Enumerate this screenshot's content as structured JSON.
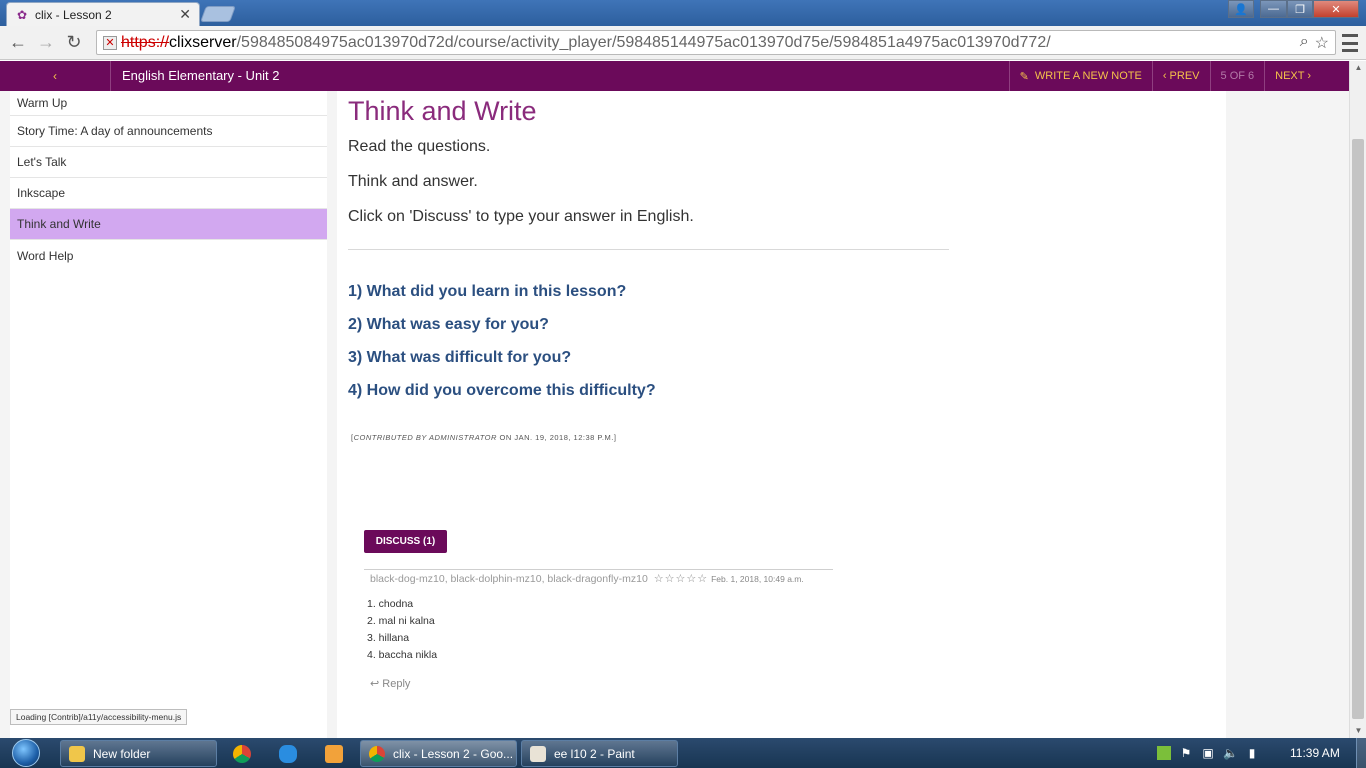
{
  "browser": {
    "tab_title": "clix - Lesson 2",
    "url": {
      "scheme": "https://",
      "host": "clixserver",
      "path": "/598485084975ac013970d72d/course/activity_player/598485144975ac013970d75e/5984851a4975ac013970d772/"
    }
  },
  "header": {
    "back_label": "‹",
    "unit_title": "English Elementary - Unit 2",
    "write_note_label": "WRITE A NEW NOTE",
    "prev_label": "‹ PREV",
    "pager_label": "5 OF 6",
    "next_label": "NEXT ›"
  },
  "sidebar": {
    "items": [
      {
        "label": "Warm Up"
      },
      {
        "label": "Story Time: A day of announcements"
      },
      {
        "label": "Let's Talk"
      },
      {
        "label": "Inkscape"
      },
      {
        "label": "Think and Write",
        "active": true
      },
      {
        "label": "Word Help"
      }
    ]
  },
  "content": {
    "title": "Think and Write",
    "instructions": [
      "Read the questions.",
      "Think and answer.",
      "Click on 'Discuss' to type your answer in English."
    ],
    "questions": [
      "1) What did you learn in this lesson?",
      "2) What was easy for you?",
      "3) What was difficult for you?",
      "4) How did you overcome this difficulty?"
    ],
    "contrib": {
      "open": "[",
      "by_label": "CONTRIBUTED BY ADMINISTRATOR",
      "date": "ON JAN. 19, 2018, 12:38 P.M.]"
    },
    "discuss_label": "DISCUSS (1)",
    "comment": {
      "authors": "black-dog-mz10, black-dolphin-mz10, black-dragonfly-mz10",
      "stars": "☆☆☆☆☆",
      "date": "Feb. 1, 2018, 10:49 a.m.",
      "answers": [
        "1. chodna",
        "2. mal ni kalna",
        "3. hillana",
        "4. baccha nikla"
      ]
    },
    "reply_label": "Reply"
  },
  "status_tip": "Loading [Contrib]/a11y/accessibility-menu.js",
  "taskbar": {
    "items": [
      {
        "label": "New folder"
      },
      {
        "label": "clix - Lesson 2 - Goo..."
      },
      {
        "label": "ee l10 2 - Paint"
      }
    ],
    "clock": "11:39 AM"
  },
  "colors": {
    "brand": "#6b0a5a",
    "accent": "#f5c24a",
    "active_item": "#d2a8f0",
    "title": "#8a2b7c",
    "question": "#2b4f80"
  }
}
